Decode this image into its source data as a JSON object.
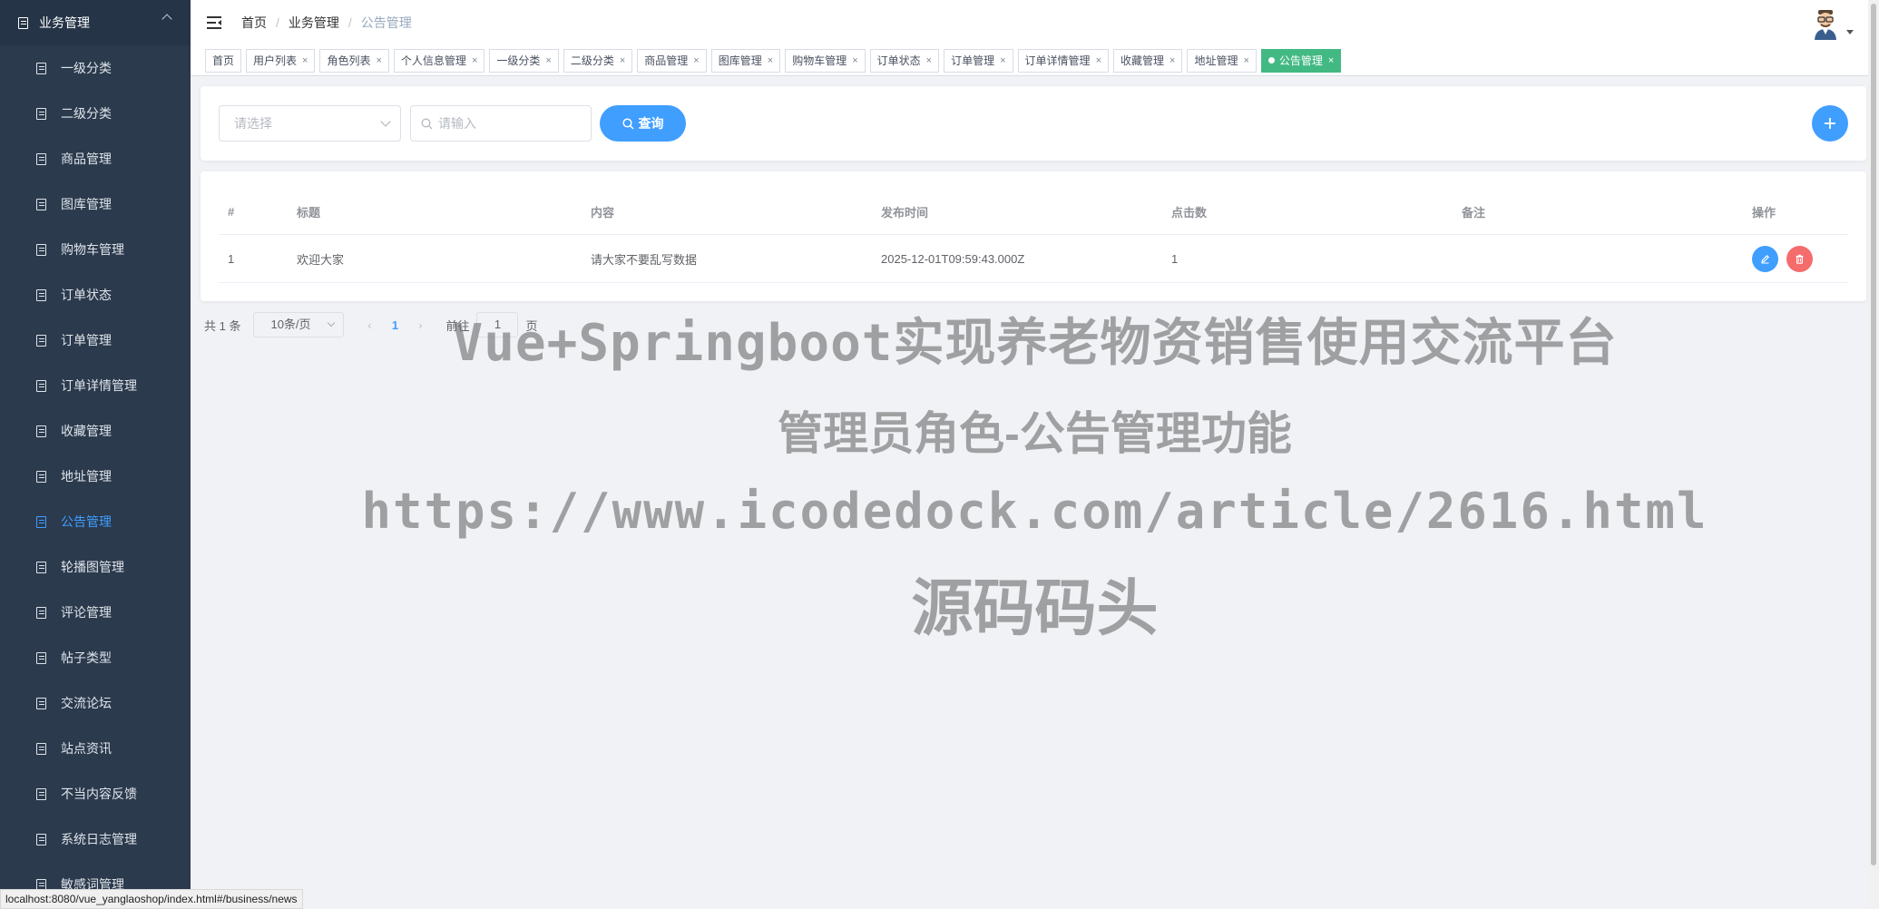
{
  "sidebar": {
    "group_label": "业务管理",
    "items": [
      {
        "label": "一级分类"
      },
      {
        "label": "二级分类"
      },
      {
        "label": "商品管理"
      },
      {
        "label": "图库管理"
      },
      {
        "label": "购物车管理"
      },
      {
        "label": "订单状态"
      },
      {
        "label": "订单管理"
      },
      {
        "label": "订单详情管理"
      },
      {
        "label": "收藏管理"
      },
      {
        "label": "地址管理"
      },
      {
        "label": "公告管理",
        "active": true
      },
      {
        "label": "轮播图管理"
      },
      {
        "label": "评论管理"
      },
      {
        "label": "帖子类型"
      },
      {
        "label": "交流论坛"
      },
      {
        "label": "站点资讯"
      },
      {
        "label": "不当内容反馈"
      },
      {
        "label": "系统日志管理"
      },
      {
        "label": "敏感词管理"
      }
    ]
  },
  "breadcrumb": {
    "home": "首页",
    "section": "业务管理",
    "current": "公告管理"
  },
  "tags": [
    {
      "label": "首页",
      "closable": false
    },
    {
      "label": "用户列表",
      "closable": true
    },
    {
      "label": "角色列表",
      "closable": true
    },
    {
      "label": "个人信息管理",
      "closable": true
    },
    {
      "label": "一级分类",
      "closable": true
    },
    {
      "label": "二级分类",
      "closable": true
    },
    {
      "label": "商品管理",
      "closable": true
    },
    {
      "label": "图库管理",
      "closable": true
    },
    {
      "label": "购物车管理",
      "closable": true
    },
    {
      "label": "订单状态",
      "closable": true
    },
    {
      "label": "订单管理",
      "closable": true
    },
    {
      "label": "订单详情管理",
      "closable": true
    },
    {
      "label": "收藏管理",
      "closable": true
    },
    {
      "label": "地址管理",
      "closable": true
    },
    {
      "label": "公告管理",
      "closable": true,
      "active": true
    }
  ],
  "search": {
    "select_placeholder": "请选择",
    "input_placeholder": "请输入",
    "query_label": "查询"
  },
  "table": {
    "headers": [
      "#",
      "标题",
      "内容",
      "发布时间",
      "点击数",
      "备注",
      "操作"
    ],
    "rows": [
      {
        "index": "1",
        "title": "欢迎大家",
        "content": "请大家不要乱写数据",
        "publish_time": "2025-12-01T09:59:43.000Z",
        "clicks": "1",
        "remark": ""
      }
    ]
  },
  "pagination": {
    "total": "共 1 条",
    "page_size": "10条/页",
    "current_page": "1",
    "goto_label": "前往",
    "goto_value": "1",
    "page_unit": "页"
  },
  "watermark": {
    "line1": "Vue+Springboot实现养老物资销售使用交流平台",
    "line2": "管理员角色-公告管理功能",
    "line3": "https://www.icodedock.com/article/2616.html",
    "line4": "源码码头"
  },
  "status_url": "localhost:8080/vue_yanglaoshop/index.html#/business/news",
  "colors": {
    "sidebar_bg": "#2b3a4d",
    "accent": "#409eff",
    "active_tag": "#42b983",
    "danger": "#f56c6c"
  }
}
